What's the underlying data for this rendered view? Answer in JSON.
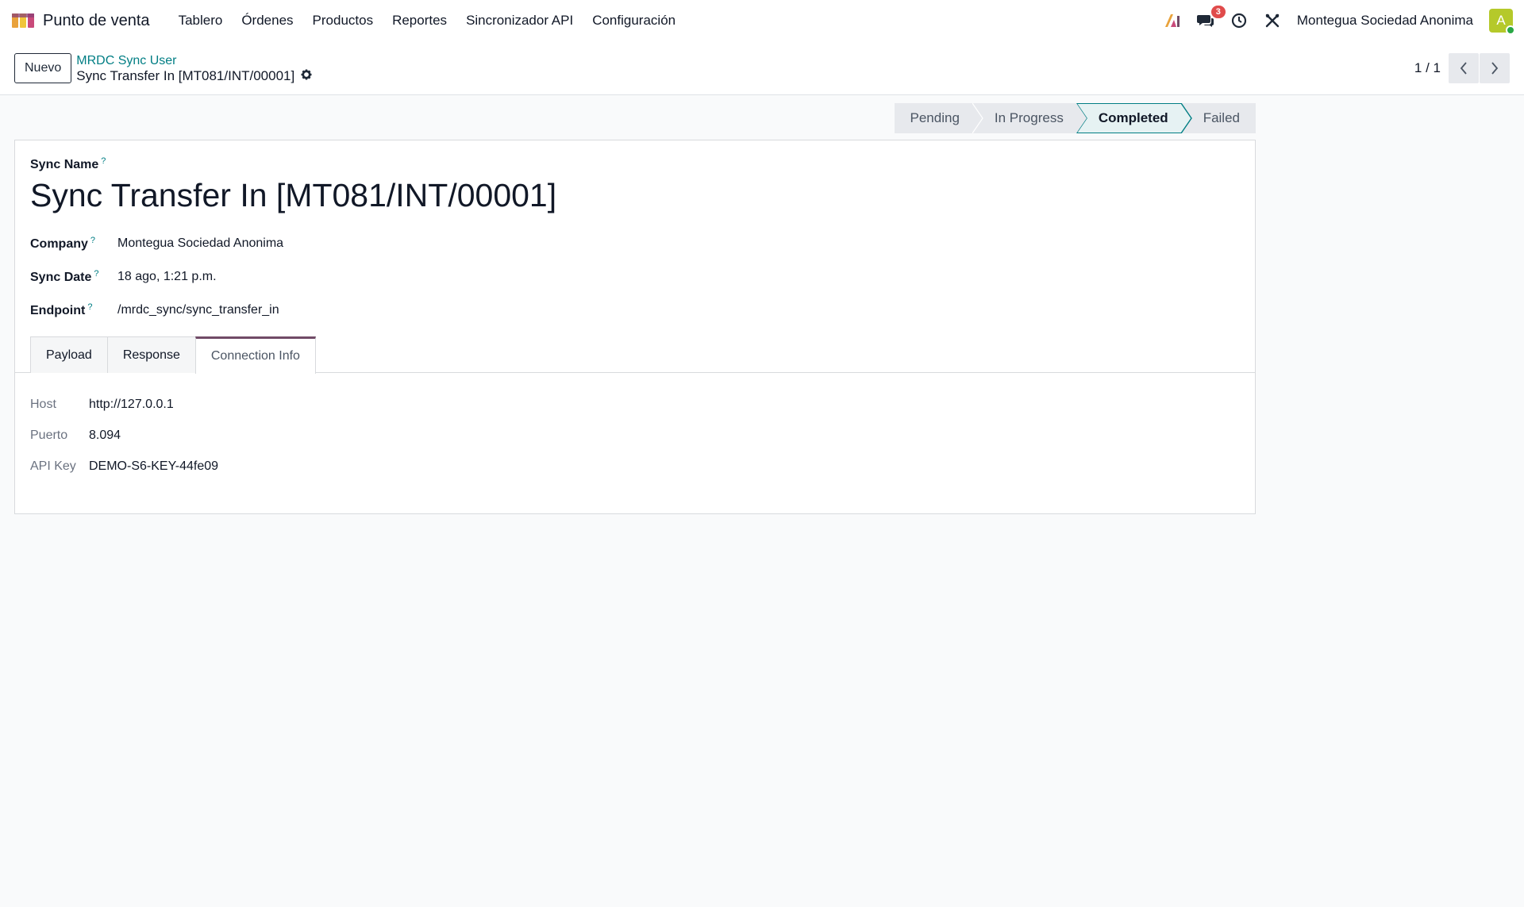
{
  "navbar": {
    "app_name": "Punto de venta",
    "menu": [
      "Tablero",
      "Órdenes",
      "Productos",
      "Reportes",
      "Sincronizador API",
      "Configuración"
    ],
    "messages_badge": "3",
    "company": "Montegua Sociedad Anonima",
    "avatar_letter": "A"
  },
  "control_panel": {
    "new_button": "Nuevo",
    "breadcrumb_parent": "MRDC Sync User",
    "breadcrumb_current": "Sync Transfer In [MT081/INT/00001]",
    "pager": "1 / 1"
  },
  "statusbar": {
    "stages": [
      "Pending",
      "In Progress",
      "Completed",
      "Failed"
    ],
    "active": "Completed"
  },
  "form": {
    "sync_name_label": "Sync Name",
    "sync_name": "Sync Transfer In [MT081/INT/00001]",
    "fields": [
      {
        "label": "Company",
        "value": "Montegua Sociedad Anonima"
      },
      {
        "label": "Sync Date",
        "value": "18 ago, 1:21 p.m."
      },
      {
        "label": "Endpoint",
        "value": "/mrdc_sync/sync_transfer_in"
      }
    ],
    "help_mark": "?",
    "tabs": [
      "Payload",
      "Response",
      "Connection Info"
    ],
    "active_tab": "Connection Info",
    "connection": [
      {
        "label": "Host",
        "value": "http://127.0.0.1"
      },
      {
        "label": "Puerto",
        "value": "8.094"
      },
      {
        "label": "API Key",
        "value": "DEMO-S6-KEY-44fe09"
      }
    ]
  },
  "colors": {
    "accent": "#714b67",
    "link": "#017e84",
    "badge": "#e04b4b",
    "avatar": "#b5c92a"
  }
}
